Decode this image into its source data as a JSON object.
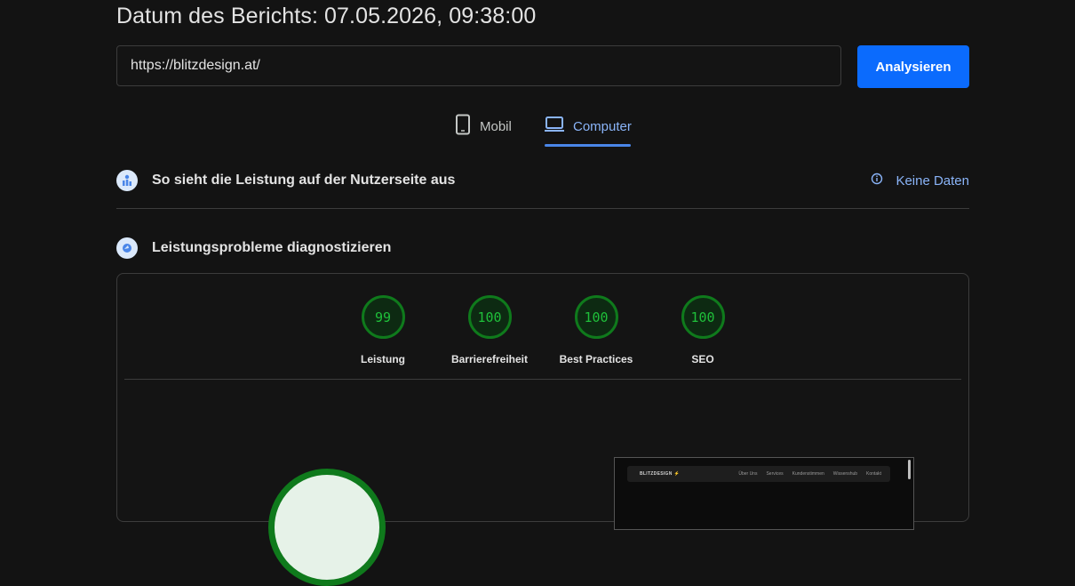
{
  "report": {
    "title": "Datum des Berichts: 07.05.2026, 09:38:00"
  },
  "url_input": {
    "value": "https://blitzdesign.at/"
  },
  "analyze_button": {
    "label": "Analysieren"
  },
  "tabs": [
    {
      "label": "Mobil",
      "icon": "smartphone-icon",
      "selected": false
    },
    {
      "label": "Computer",
      "icon": "laptop-icon",
      "selected": true
    }
  ],
  "field_data": {
    "title": "So sieht die Leistung auf der Nutzerseite aus",
    "status": "Keine Daten"
  },
  "diagnostics": {
    "title": "Leistungsprobleme diagnostizieren",
    "scores": [
      {
        "value": "99",
        "label": "Leistung"
      },
      {
        "value": "100",
        "label": "Barrierefreiheit"
      },
      {
        "value": "100",
        "label": "Best Practices"
      },
      {
        "value": "100",
        "label": "SEO"
      }
    ]
  },
  "screenshot_preview": {
    "brand": "BLITZDESIGN",
    "nav_links": [
      "Über Uns",
      "Services",
      "Kundenstimmen",
      "Wissenshub",
      "Kontakt"
    ]
  },
  "colors": {
    "accent": "#0b6bfd",
    "pass": "#0f7a1c",
    "link": "#8ab4f8",
    "background": "#131313"
  }
}
